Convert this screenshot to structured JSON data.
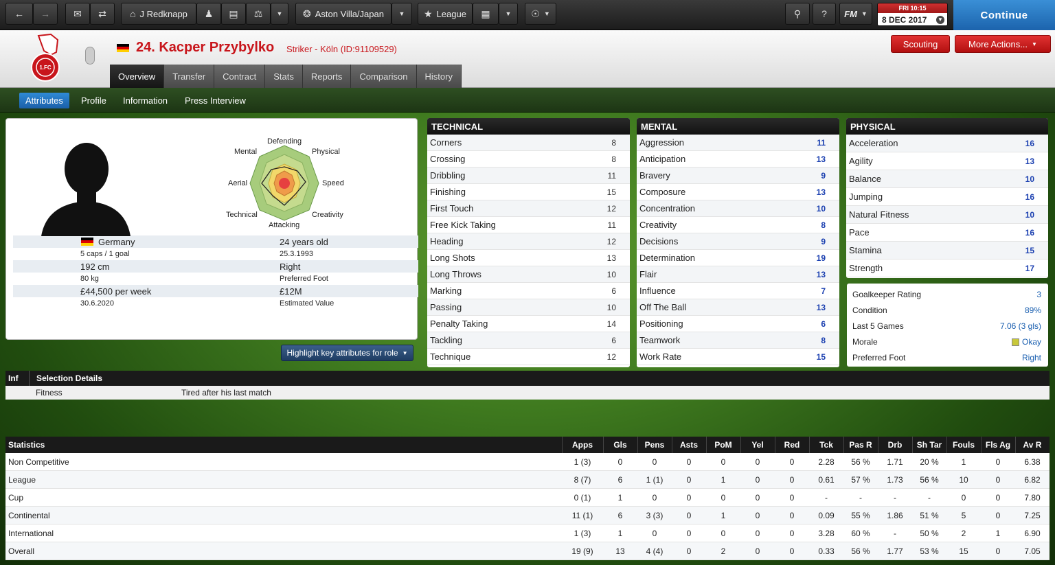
{
  "toolbar": {
    "manager": "J Redknapp",
    "team": "Aston Villa/Japan",
    "competition": "League",
    "fm_label": "FM",
    "date_day": "FRI 10:15",
    "date": "8 DEC 2017",
    "continue": "Continue"
  },
  "player": {
    "name": "24. Kacper Przybylko",
    "subtitle": "Striker - Köln (ID:91109529)",
    "nationality": "Germany",
    "caps": "5 caps / 1 goal",
    "height": "192 cm",
    "weight": "80 kg",
    "wage": "£44,500 per week",
    "contract_end": "30.6.2020",
    "age": "24 years old",
    "dob": "25.3.1993",
    "foot": "Right",
    "foot_label": "Preferred Foot",
    "value": "£12M",
    "value_label": "Estimated Value"
  },
  "header_buttons": {
    "scouting": "Scouting",
    "more_actions": "More Actions..."
  },
  "tabs": [
    "Overview",
    "Transfer",
    "Contract",
    "Stats",
    "Reports",
    "Comparison",
    "History"
  ],
  "subtabs": [
    "Attributes",
    "Profile",
    "Information",
    "Press Interview"
  ],
  "radar_labels": {
    "defending": "Defending",
    "physical": "Physical",
    "speed": "Speed",
    "creativity": "Creativity",
    "attacking": "Attacking",
    "technical": "Technical",
    "aerial": "Aerial",
    "mental": "Mental"
  },
  "highlight_btn": "Highlight key attributes for role",
  "technical": {
    "title": "TECHNICAL",
    "items": [
      {
        "name": "Corners",
        "value": "8"
      },
      {
        "name": "Crossing",
        "value": "8"
      },
      {
        "name": "Dribbling",
        "value": "11"
      },
      {
        "name": "Finishing",
        "value": "15"
      },
      {
        "name": "First Touch",
        "value": "12"
      },
      {
        "name": "Free Kick Taking",
        "value": "11"
      },
      {
        "name": "Heading",
        "value": "12"
      },
      {
        "name": "Long Shots",
        "value": "13"
      },
      {
        "name": "Long Throws",
        "value": "10"
      },
      {
        "name": "Marking",
        "value": "6"
      },
      {
        "name": "Passing",
        "value": "10"
      },
      {
        "name": "Penalty Taking",
        "value": "14"
      },
      {
        "name": "Tackling",
        "value": "6"
      },
      {
        "name": "Technique",
        "value": "12"
      }
    ]
  },
  "mental": {
    "title": "MENTAL",
    "items": [
      {
        "name": "Aggression",
        "value": "11"
      },
      {
        "name": "Anticipation",
        "value": "13"
      },
      {
        "name": "Bravery",
        "value": "9"
      },
      {
        "name": "Composure",
        "value": "13"
      },
      {
        "name": "Concentration",
        "value": "10"
      },
      {
        "name": "Creativity",
        "value": "8"
      },
      {
        "name": "Decisions",
        "value": "9"
      },
      {
        "name": "Determination",
        "value": "19"
      },
      {
        "name": "Flair",
        "value": "13"
      },
      {
        "name": "Influence",
        "value": "7"
      },
      {
        "name": "Off The Ball",
        "value": "13"
      },
      {
        "name": "Positioning",
        "value": "6"
      },
      {
        "name": "Teamwork",
        "value": "8"
      },
      {
        "name": "Work Rate",
        "value": "15"
      }
    ]
  },
  "physical": {
    "title": "PHYSICAL",
    "items": [
      {
        "name": "Acceleration",
        "value": "16"
      },
      {
        "name": "Agility",
        "value": "13"
      },
      {
        "name": "Balance",
        "value": "10"
      },
      {
        "name": "Jumping",
        "value": "16"
      },
      {
        "name": "Natural Fitness",
        "value": "10"
      },
      {
        "name": "Pace",
        "value": "16"
      },
      {
        "name": "Stamina",
        "value": "15"
      },
      {
        "name": "Strength",
        "value": "17"
      }
    ]
  },
  "gk": [
    {
      "label": "Goalkeeper Rating",
      "value": "3"
    },
    {
      "label": "Condition",
      "value": "89%"
    },
    {
      "label": "Last 5 Games",
      "value": "7.06 (3 gls)"
    },
    {
      "label": "Morale",
      "value": "Okay"
    },
    {
      "label": "Preferred Foot",
      "value": "Right"
    }
  ],
  "selection": {
    "col1": "Inf",
    "col2": "Selection Details",
    "row_label": "Fitness",
    "row_value": "Tired after his last match"
  },
  "stats": {
    "headers": [
      "Statistics",
      "Apps",
      "Gls",
      "Pens",
      "Asts",
      "PoM",
      "Yel",
      "Red",
      "Tck",
      "Pas R",
      "Drb",
      "Sh Tar",
      "Fouls",
      "Fls Ag",
      "Av R"
    ],
    "rows": [
      [
        "Non Competitive",
        "1 (3)",
        "0",
        "0",
        "0",
        "0",
        "0",
        "0",
        "2.28",
        "56 %",
        "1.71",
        "20 %",
        "1",
        "0",
        "6.38"
      ],
      [
        "League",
        "8 (7)",
        "6",
        "1 (1)",
        "0",
        "1",
        "0",
        "0",
        "0.61",
        "57 %",
        "1.73",
        "56 %",
        "10",
        "0",
        "6.82"
      ],
      [
        "Cup",
        "0 (1)",
        "1",
        "0",
        "0",
        "0",
        "0",
        "0",
        "-",
        "-",
        "-",
        "-",
        "0",
        "0",
        "7.80"
      ],
      [
        "Continental",
        "11 (1)",
        "6",
        "3 (3)",
        "0",
        "1",
        "0",
        "0",
        "0.09",
        "55 %",
        "1.86",
        "51 %",
        "5",
        "0",
        "7.25"
      ],
      [
        "International",
        "1 (3)",
        "1",
        "0",
        "0",
        "0",
        "0",
        "0",
        "3.28",
        "60 %",
        "-",
        "50 %",
        "2",
        "1",
        "6.90"
      ],
      [
        "Overall",
        "19 (9)",
        "13",
        "4 (4)",
        "0",
        "2",
        "0",
        "0",
        "0.33",
        "56 %",
        "1.77",
        "53 %",
        "15",
        "0",
        "7.05"
      ]
    ]
  }
}
